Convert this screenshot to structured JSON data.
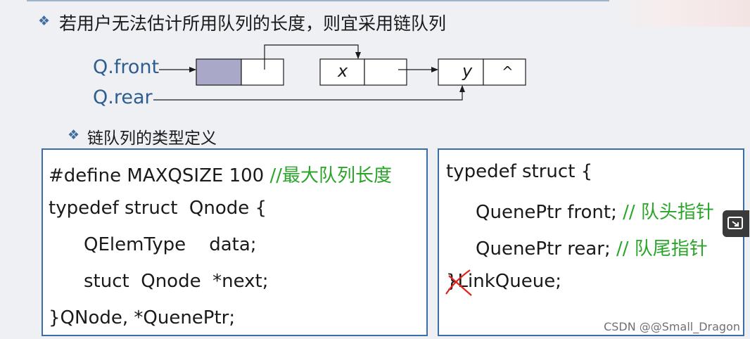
{
  "heading": "若用户无法估计所用队列的长度，则宜采用链队列",
  "subheading": "链队列的类型定义",
  "bullet_glyph": "❖",
  "diagram": {
    "front_label": "Q.front",
    "rear_label": "Q.rear",
    "node2_data": "x",
    "node3_data": "y",
    "null_marker": "^"
  },
  "left_code": {
    "line1_code": "#define MAXQSIZE 100 ",
    "line1_comment": "//最大队列长度",
    "line2": "typedef struct  Qnode {",
    "line3": "QElemType    data;",
    "line4": "stuct  Qnode  *next;",
    "line5": "}QNode, *QuenePtr;"
  },
  "right_code": {
    "line1": "typedef struct {",
    "line2_code": "QuenePtr front; ",
    "line2_comment": "// 队头指针",
    "line3_code": "QuenePtr rear; ",
    "line3_comment": "// 队尾指针",
    "line4": "}LinkQueue;"
  },
  "watermark": "CSDN @@Small_Dragon",
  "colors": {
    "comment": "#2aa52a",
    "box_border": "#3a6ea5",
    "pointer_label": "#2e5e8e",
    "head_node_fill": "#a9a8c9",
    "strike": "#e0231b"
  }
}
